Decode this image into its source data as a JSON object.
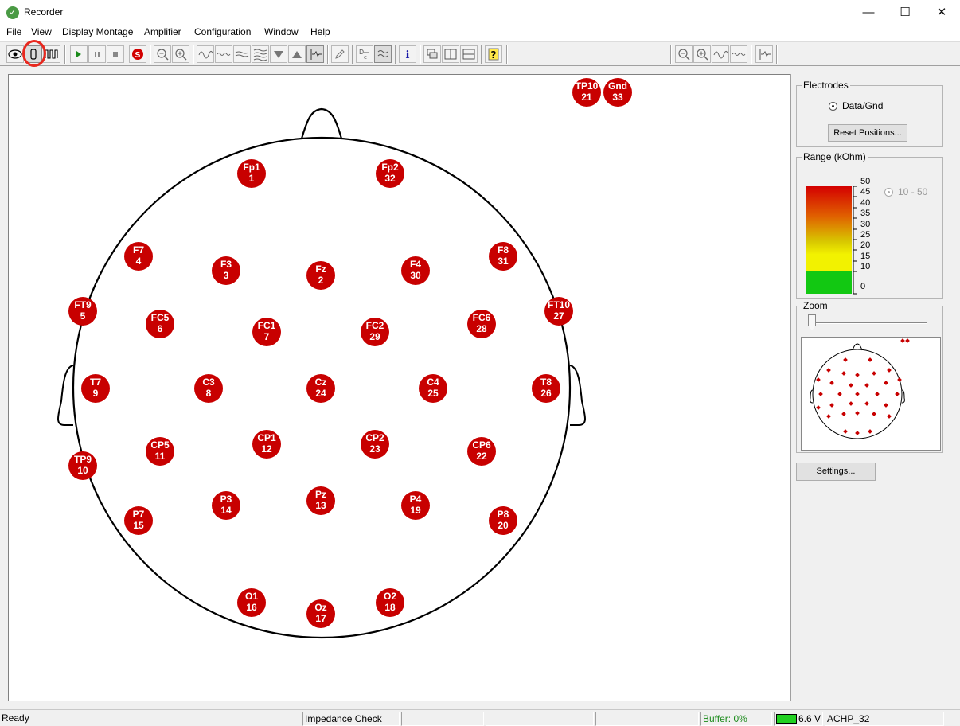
{
  "window": {
    "title": "Recorder",
    "minimize": "—",
    "maximize": "☐",
    "close": "✕"
  },
  "menu": [
    "File",
    "View",
    "Display Montage",
    "Amplifier",
    "Configuration",
    "Window",
    "Help"
  ],
  "toolbar": {
    "left_icons": [
      "eye-icon",
      "impedance-icon",
      "signal-icon",
      "play-icon",
      "pause-icon",
      "stop-icon",
      "record-icon",
      "zoom-out-icon",
      "zoom-in-icon",
      "wave-icon",
      "wave-small-icon",
      "wave-flat-icon",
      "wave-stack-icon",
      "arrow-down-icon",
      "arrow-up-icon",
      "marker-icon",
      "pencil-icon",
      "dc-icon",
      "filter-icon",
      "info-icon",
      "montage-icon",
      "split-vertical-icon",
      "split-horizontal-icon",
      "help-icon"
    ],
    "right_icons": [
      "zoom-out-icon",
      "zoom-in-icon",
      "wave-icon",
      "wave-small-icon",
      "marker-icon"
    ],
    "active_tool": "impedance-icon"
  },
  "electrodes": [
    {
      "label": "Fp1",
      "number": "1"
    },
    {
      "label": "Fz",
      "number": "2"
    },
    {
      "label": "F3",
      "number": "3"
    },
    {
      "label": "F7",
      "number": "4"
    },
    {
      "label": "FT9",
      "number": "5"
    },
    {
      "label": "FC5",
      "number": "6"
    },
    {
      "label": "FC1",
      "number": "7"
    },
    {
      "label": "C3",
      "number": "8"
    },
    {
      "label": "T7",
      "number": "9"
    },
    {
      "label": "TP9",
      "number": "10"
    },
    {
      "label": "CP5",
      "number": "11"
    },
    {
      "label": "CP1",
      "number": "12"
    },
    {
      "label": "Pz",
      "number": "13"
    },
    {
      "label": "P3",
      "number": "14"
    },
    {
      "label": "P7",
      "number": "15"
    },
    {
      "label": "O1",
      "number": "16"
    },
    {
      "label": "Oz",
      "number": "17"
    },
    {
      "label": "O2",
      "number": "18"
    },
    {
      "label": "P4",
      "number": "19"
    },
    {
      "label": "P8",
      "number": "20"
    },
    {
      "label": "TP10",
      "number": "21"
    },
    {
      "label": "CP6",
      "number": "22"
    },
    {
      "label": "CP2",
      "number": "23"
    },
    {
      "label": "Cz",
      "number": "24"
    },
    {
      "label": "C4",
      "number": "25"
    },
    {
      "label": "T8",
      "number": "26"
    },
    {
      "label": "FT10",
      "number": "27"
    },
    {
      "label": "FC6",
      "number": "28"
    },
    {
      "label": "FC2",
      "number": "29"
    },
    {
      "label": "F4",
      "number": "30"
    },
    {
      "label": "F8",
      "number": "31"
    },
    {
      "label": "Fp2",
      "number": "32"
    },
    {
      "label": "Gnd",
      "number": "33"
    }
  ],
  "electrode_color": "#c80000",
  "panel": {
    "electrodes_title": "Electrodes",
    "data_gnd_label": "Data/Gnd",
    "reset_button": "Reset Positions...",
    "range_title": "Range (kOhm)",
    "range_ticks": [
      "50",
      "45",
      "40",
      "35",
      "30",
      "25",
      "20",
      "15",
      "10",
      "0"
    ],
    "range_option": "10 - 50",
    "zoom_title": "Zoom",
    "zoom_level": 0,
    "settings_button": "Settings..."
  },
  "status": {
    "ready": "Ready",
    "mode": "Impedance Check",
    "buffer": "Buffer: 0%",
    "voltage": "6.6 V",
    "amplifier": "ACHP_32"
  }
}
